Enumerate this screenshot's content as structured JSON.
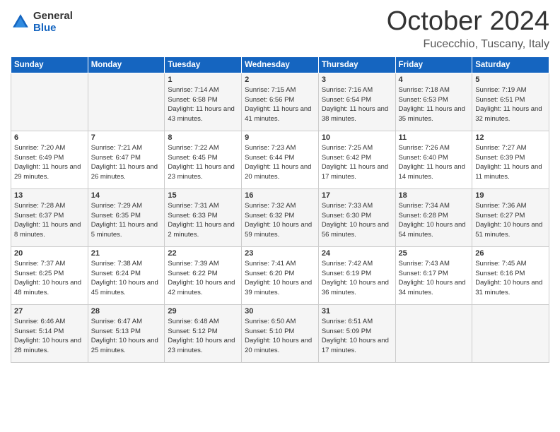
{
  "header": {
    "logo_line1": "General",
    "logo_line2": "Blue",
    "month": "October 2024",
    "location": "Fucecchio, Tuscany, Italy"
  },
  "days_of_week": [
    "Sunday",
    "Monday",
    "Tuesday",
    "Wednesday",
    "Thursday",
    "Friday",
    "Saturday"
  ],
  "weeks": [
    [
      {
        "day": "",
        "sunrise": "",
        "sunset": "",
        "daylight": ""
      },
      {
        "day": "",
        "sunrise": "",
        "sunset": "",
        "daylight": ""
      },
      {
        "day": "1",
        "sunrise": "Sunrise: 7:14 AM",
        "sunset": "Sunset: 6:58 PM",
        "daylight": "Daylight: 11 hours and 43 minutes."
      },
      {
        "day": "2",
        "sunrise": "Sunrise: 7:15 AM",
        "sunset": "Sunset: 6:56 PM",
        "daylight": "Daylight: 11 hours and 41 minutes."
      },
      {
        "day": "3",
        "sunrise": "Sunrise: 7:16 AM",
        "sunset": "Sunset: 6:54 PM",
        "daylight": "Daylight: 11 hours and 38 minutes."
      },
      {
        "day": "4",
        "sunrise": "Sunrise: 7:18 AM",
        "sunset": "Sunset: 6:53 PM",
        "daylight": "Daylight: 11 hours and 35 minutes."
      },
      {
        "day": "5",
        "sunrise": "Sunrise: 7:19 AM",
        "sunset": "Sunset: 6:51 PM",
        "daylight": "Daylight: 11 hours and 32 minutes."
      }
    ],
    [
      {
        "day": "6",
        "sunrise": "Sunrise: 7:20 AM",
        "sunset": "Sunset: 6:49 PM",
        "daylight": "Daylight: 11 hours and 29 minutes."
      },
      {
        "day": "7",
        "sunrise": "Sunrise: 7:21 AM",
        "sunset": "Sunset: 6:47 PM",
        "daylight": "Daylight: 11 hours and 26 minutes."
      },
      {
        "day": "8",
        "sunrise": "Sunrise: 7:22 AM",
        "sunset": "Sunset: 6:45 PM",
        "daylight": "Daylight: 11 hours and 23 minutes."
      },
      {
        "day": "9",
        "sunrise": "Sunrise: 7:23 AM",
        "sunset": "Sunset: 6:44 PM",
        "daylight": "Daylight: 11 hours and 20 minutes."
      },
      {
        "day": "10",
        "sunrise": "Sunrise: 7:25 AM",
        "sunset": "Sunset: 6:42 PM",
        "daylight": "Daylight: 11 hours and 17 minutes."
      },
      {
        "day": "11",
        "sunrise": "Sunrise: 7:26 AM",
        "sunset": "Sunset: 6:40 PM",
        "daylight": "Daylight: 11 hours and 14 minutes."
      },
      {
        "day": "12",
        "sunrise": "Sunrise: 7:27 AM",
        "sunset": "Sunset: 6:39 PM",
        "daylight": "Daylight: 11 hours and 11 minutes."
      }
    ],
    [
      {
        "day": "13",
        "sunrise": "Sunrise: 7:28 AM",
        "sunset": "Sunset: 6:37 PM",
        "daylight": "Daylight: 11 hours and 8 minutes."
      },
      {
        "day": "14",
        "sunrise": "Sunrise: 7:29 AM",
        "sunset": "Sunset: 6:35 PM",
        "daylight": "Daylight: 11 hours and 5 minutes."
      },
      {
        "day": "15",
        "sunrise": "Sunrise: 7:31 AM",
        "sunset": "Sunset: 6:33 PM",
        "daylight": "Daylight: 11 hours and 2 minutes."
      },
      {
        "day": "16",
        "sunrise": "Sunrise: 7:32 AM",
        "sunset": "Sunset: 6:32 PM",
        "daylight": "Daylight: 10 hours and 59 minutes."
      },
      {
        "day": "17",
        "sunrise": "Sunrise: 7:33 AM",
        "sunset": "Sunset: 6:30 PM",
        "daylight": "Daylight: 10 hours and 56 minutes."
      },
      {
        "day": "18",
        "sunrise": "Sunrise: 7:34 AM",
        "sunset": "Sunset: 6:28 PM",
        "daylight": "Daylight: 10 hours and 54 minutes."
      },
      {
        "day": "19",
        "sunrise": "Sunrise: 7:36 AM",
        "sunset": "Sunset: 6:27 PM",
        "daylight": "Daylight: 10 hours and 51 minutes."
      }
    ],
    [
      {
        "day": "20",
        "sunrise": "Sunrise: 7:37 AM",
        "sunset": "Sunset: 6:25 PM",
        "daylight": "Daylight: 10 hours and 48 minutes."
      },
      {
        "day": "21",
        "sunrise": "Sunrise: 7:38 AM",
        "sunset": "Sunset: 6:24 PM",
        "daylight": "Daylight: 10 hours and 45 minutes."
      },
      {
        "day": "22",
        "sunrise": "Sunrise: 7:39 AM",
        "sunset": "Sunset: 6:22 PM",
        "daylight": "Daylight: 10 hours and 42 minutes."
      },
      {
        "day": "23",
        "sunrise": "Sunrise: 7:41 AM",
        "sunset": "Sunset: 6:20 PM",
        "daylight": "Daylight: 10 hours and 39 minutes."
      },
      {
        "day": "24",
        "sunrise": "Sunrise: 7:42 AM",
        "sunset": "Sunset: 6:19 PM",
        "daylight": "Daylight: 10 hours and 36 minutes."
      },
      {
        "day": "25",
        "sunrise": "Sunrise: 7:43 AM",
        "sunset": "Sunset: 6:17 PM",
        "daylight": "Daylight: 10 hours and 34 minutes."
      },
      {
        "day": "26",
        "sunrise": "Sunrise: 7:45 AM",
        "sunset": "Sunset: 6:16 PM",
        "daylight": "Daylight: 10 hours and 31 minutes."
      }
    ],
    [
      {
        "day": "27",
        "sunrise": "Sunrise: 6:46 AM",
        "sunset": "Sunset: 5:14 PM",
        "daylight": "Daylight: 10 hours and 28 minutes."
      },
      {
        "day": "28",
        "sunrise": "Sunrise: 6:47 AM",
        "sunset": "Sunset: 5:13 PM",
        "daylight": "Daylight: 10 hours and 25 minutes."
      },
      {
        "day": "29",
        "sunrise": "Sunrise: 6:48 AM",
        "sunset": "Sunset: 5:12 PM",
        "daylight": "Daylight: 10 hours and 23 minutes."
      },
      {
        "day": "30",
        "sunrise": "Sunrise: 6:50 AM",
        "sunset": "Sunset: 5:10 PM",
        "daylight": "Daylight: 10 hours and 20 minutes."
      },
      {
        "day": "31",
        "sunrise": "Sunrise: 6:51 AM",
        "sunset": "Sunset: 5:09 PM",
        "daylight": "Daylight: 10 hours and 17 minutes."
      },
      {
        "day": "",
        "sunrise": "",
        "sunset": "",
        "daylight": ""
      },
      {
        "day": "",
        "sunrise": "",
        "sunset": "",
        "daylight": ""
      }
    ]
  ]
}
